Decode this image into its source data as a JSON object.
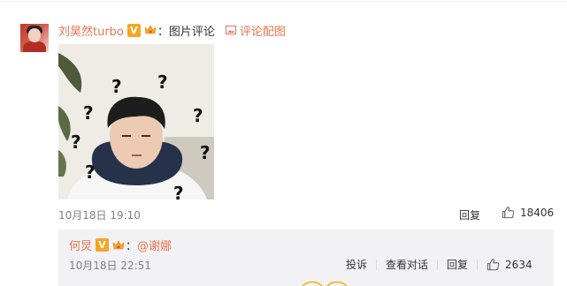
{
  "comment": {
    "username": "刘昊然turbo",
    "vip_badge": "V",
    "colon": "：",
    "text": "图片评论",
    "image_link": "评论配图",
    "date": "10月18日 19:10",
    "reply_label": "回复",
    "like_count": "18406"
  },
  "reply": {
    "username": "何炅",
    "vip_badge": "V",
    "colon": "：",
    "mention": "@谢娜",
    "date": "10月18日 22:51",
    "report_label": "投诉",
    "view_conversation_label": "查看对话",
    "reply_label": "回复",
    "like_count": "2634"
  },
  "colors": {
    "accent": "#eb7350",
    "badge": "#f5a623",
    "muted": "#808080",
    "reply_bg": "#f2f2f5"
  }
}
